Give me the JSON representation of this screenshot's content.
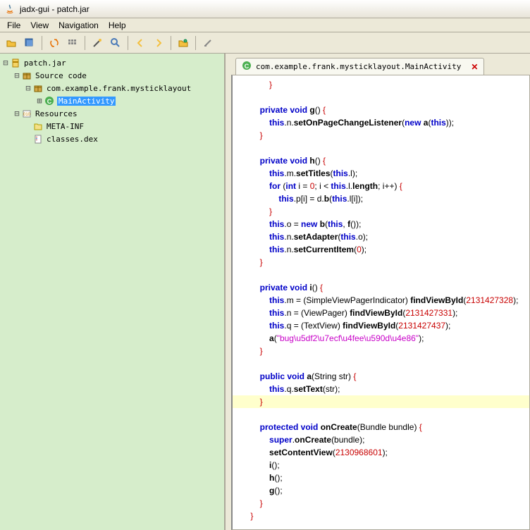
{
  "window": {
    "title": "jadx-gui - patch.jar"
  },
  "menu": {
    "file": "File",
    "view": "View",
    "navigation": "Navigation",
    "help": "Help"
  },
  "tree": {
    "root": "patch.jar",
    "source_code": "Source code",
    "package": "com.example.frank.mysticklayout",
    "class": "MainActivity",
    "resources": "Resources",
    "meta_inf": "META-INF",
    "classes_dex": "classes.dex"
  },
  "tab": {
    "title": "com.example.frank.mysticklayout.MainActivity",
    "close": "✕"
  },
  "code": [
    {
      "i": 3,
      "t": [
        {
          "c": "brace",
          "v": "}"
        }
      ]
    },
    {
      "t": []
    },
    {
      "i": 2,
      "t": [
        {
          "c": "kw",
          "v": "private void"
        },
        {
          "v": " "
        },
        {
          "c": "mth",
          "v": "g"
        },
        {
          "v": "() "
        },
        {
          "c": "brace",
          "v": "{"
        }
      ]
    },
    {
      "i": 3,
      "t": [
        {
          "c": "kw",
          "v": "this"
        },
        {
          "v": ".n."
        },
        {
          "c": "mth",
          "v": "setOnPageChangeListener"
        },
        {
          "v": "("
        },
        {
          "c": "kw",
          "v": "new"
        },
        {
          "v": " "
        },
        {
          "c": "mth",
          "v": "a"
        },
        {
          "v": "("
        },
        {
          "c": "kw",
          "v": "this"
        },
        {
          "v": "));"
        }
      ]
    },
    {
      "i": 2,
      "t": [
        {
          "c": "brace",
          "v": "}"
        }
      ]
    },
    {
      "t": []
    },
    {
      "i": 2,
      "t": [
        {
          "c": "kw",
          "v": "private void"
        },
        {
          "v": " "
        },
        {
          "c": "mth",
          "v": "h"
        },
        {
          "v": "() "
        },
        {
          "c": "brace",
          "v": "{"
        }
      ]
    },
    {
      "i": 3,
      "t": [
        {
          "c": "kw",
          "v": "this"
        },
        {
          "v": ".m."
        },
        {
          "c": "mth",
          "v": "setTitles"
        },
        {
          "v": "("
        },
        {
          "c": "kw",
          "v": "this"
        },
        {
          "v": ".l);"
        }
      ]
    },
    {
      "i": 3,
      "t": [
        {
          "c": "kw",
          "v": "for"
        },
        {
          "v": " ("
        },
        {
          "c": "kw",
          "v": "int"
        },
        {
          "v": " i = "
        },
        {
          "c": "num",
          "v": "0"
        },
        {
          "v": "; i < "
        },
        {
          "c": "kw",
          "v": "this"
        },
        {
          "v": ".l."
        },
        {
          "c": "mth",
          "v": "length"
        },
        {
          "v": "; i++) "
        },
        {
          "c": "brace",
          "v": "{"
        }
      ]
    },
    {
      "i": 4,
      "t": [
        {
          "c": "kw",
          "v": "this"
        },
        {
          "v": ".p[i] = d."
        },
        {
          "c": "mth",
          "v": "b"
        },
        {
          "v": "("
        },
        {
          "c": "kw",
          "v": "this"
        },
        {
          "v": ".l[i]);"
        }
      ]
    },
    {
      "i": 3,
      "t": [
        {
          "c": "brace",
          "v": "}"
        }
      ]
    },
    {
      "i": 3,
      "t": [
        {
          "c": "kw",
          "v": "this"
        },
        {
          "v": ".o = "
        },
        {
          "c": "kw",
          "v": "new"
        },
        {
          "v": " "
        },
        {
          "c": "mth",
          "v": "b"
        },
        {
          "v": "("
        },
        {
          "c": "kw",
          "v": "this"
        },
        {
          "v": ", "
        },
        {
          "c": "mth",
          "v": "f"
        },
        {
          "v": "());"
        }
      ]
    },
    {
      "i": 3,
      "t": [
        {
          "c": "kw",
          "v": "this"
        },
        {
          "v": ".n."
        },
        {
          "c": "mth",
          "v": "setAdapter"
        },
        {
          "v": "("
        },
        {
          "c": "kw",
          "v": "this"
        },
        {
          "v": ".o);"
        }
      ]
    },
    {
      "i": 3,
      "t": [
        {
          "c": "kw",
          "v": "this"
        },
        {
          "v": ".n."
        },
        {
          "c": "mth",
          "v": "setCurrentItem"
        },
        {
          "v": "("
        },
        {
          "c": "num",
          "v": "0"
        },
        {
          "v": ");"
        }
      ]
    },
    {
      "i": 2,
      "t": [
        {
          "c": "brace",
          "v": "}"
        }
      ]
    },
    {
      "t": []
    },
    {
      "i": 2,
      "t": [
        {
          "c": "kw",
          "v": "private void"
        },
        {
          "v": " "
        },
        {
          "c": "mth",
          "v": "i"
        },
        {
          "v": "() "
        },
        {
          "c": "brace",
          "v": "{"
        }
      ]
    },
    {
      "i": 3,
      "t": [
        {
          "c": "kw",
          "v": "this"
        },
        {
          "v": ".m = (SimpleViewPagerIndicator) "
        },
        {
          "c": "mth",
          "v": "findViewById"
        },
        {
          "v": "("
        },
        {
          "c": "num",
          "v": "2131427328"
        },
        {
          "v": ");"
        }
      ]
    },
    {
      "i": 3,
      "t": [
        {
          "c": "kw",
          "v": "this"
        },
        {
          "v": ".n = (ViewPager) "
        },
        {
          "c": "mth",
          "v": "findViewById"
        },
        {
          "v": "("
        },
        {
          "c": "num",
          "v": "2131427331"
        },
        {
          "v": ");"
        }
      ]
    },
    {
      "i": 3,
      "t": [
        {
          "c": "kw",
          "v": "this"
        },
        {
          "v": ".q = (TextView) "
        },
        {
          "c": "mth",
          "v": "findViewById"
        },
        {
          "v": "("
        },
        {
          "c": "num",
          "v": "2131427437"
        },
        {
          "v": ");"
        }
      ]
    },
    {
      "i": 3,
      "t": [
        {
          "c": "mth",
          "v": "a"
        },
        {
          "v": "("
        },
        {
          "c": "str",
          "v": "\"bug\\u5df2\\u7ecf\\u4fee\\u590d\\u4e86\""
        },
        {
          "v": ");"
        }
      ]
    },
    {
      "i": 2,
      "t": [
        {
          "c": "brace",
          "v": "}"
        }
      ]
    },
    {
      "t": []
    },
    {
      "i": 2,
      "t": [
        {
          "c": "kw",
          "v": "public void"
        },
        {
          "v": " "
        },
        {
          "c": "mth",
          "v": "a"
        },
        {
          "v": "(String str) "
        },
        {
          "c": "brace",
          "v": "{"
        }
      ]
    },
    {
      "i": 3,
      "t": [
        {
          "c": "kw",
          "v": "this"
        },
        {
          "v": ".q."
        },
        {
          "c": "mth",
          "v": "setText"
        },
        {
          "v": "(str);"
        }
      ]
    },
    {
      "i": 2,
      "hl": true,
      "t": [
        {
          "c": "brace",
          "v": "}"
        }
      ]
    },
    {
      "t": []
    },
    {
      "i": 2,
      "t": [
        {
          "c": "kw",
          "v": "protected void"
        },
        {
          "v": " "
        },
        {
          "c": "mth",
          "v": "onCreate"
        },
        {
          "v": "(Bundle bundle) "
        },
        {
          "c": "brace",
          "v": "{"
        }
      ]
    },
    {
      "i": 3,
      "t": [
        {
          "c": "kw",
          "v": "super"
        },
        {
          "v": "."
        },
        {
          "c": "mth",
          "v": "onCreate"
        },
        {
          "v": "(bundle);"
        }
      ]
    },
    {
      "i": 3,
      "t": [
        {
          "c": "mth",
          "v": "setContentView"
        },
        {
          "v": "("
        },
        {
          "c": "num",
          "v": "2130968601"
        },
        {
          "v": ");"
        }
      ]
    },
    {
      "i": 3,
      "t": [
        {
          "c": "mth",
          "v": "i"
        },
        {
          "v": "();"
        }
      ]
    },
    {
      "i": 3,
      "t": [
        {
          "c": "mth",
          "v": "h"
        },
        {
          "v": "();"
        }
      ]
    },
    {
      "i": 3,
      "t": [
        {
          "c": "mth",
          "v": "g"
        },
        {
          "v": "();"
        }
      ]
    },
    {
      "i": 2,
      "t": [
        {
          "c": "brace",
          "v": "}"
        }
      ]
    },
    {
      "i": 1,
      "t": [
        {
          "c": "brace",
          "v": "}"
        }
      ]
    }
  ]
}
